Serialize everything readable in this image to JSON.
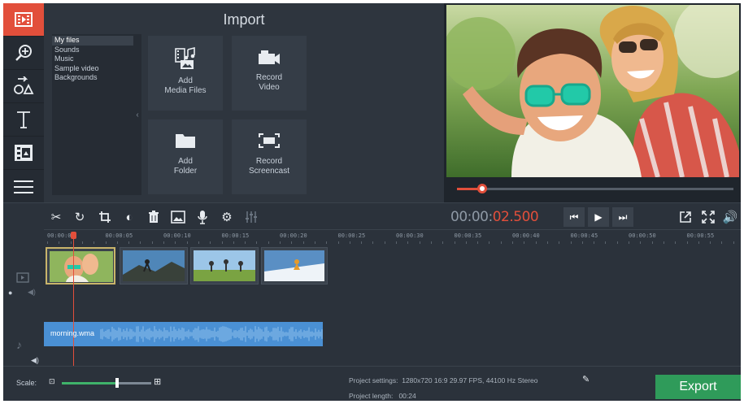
{
  "sidebar": {
    "items": [
      {
        "icon": "import-film-icon",
        "active": true
      },
      {
        "icon": "magic-wand-search-icon",
        "active": false
      },
      {
        "icon": "transitions-shapes-icon",
        "active": false
      },
      {
        "icon": "text-t-icon",
        "active": false
      },
      {
        "icon": "stickers-icon",
        "active": false
      },
      {
        "icon": "menu-list-icon",
        "active": false
      }
    ]
  },
  "import": {
    "title": "Import",
    "categories": [
      "My files",
      "Sounds",
      "Music",
      "Sample video",
      "Backgrounds"
    ],
    "selected_category": "My files",
    "tiles": {
      "add_media": "Add\nMedia Files",
      "record_video": "Record\nVideo",
      "add_folder": "Add\nFolder",
      "record_screencast": "Record\nScreencast"
    }
  },
  "player": {
    "progress": 0.09,
    "timecode_gray": "00:00:",
    "timecode_red": "02.500"
  },
  "ruler": {
    "ticks": [
      "00:00:00",
      "00:00:05",
      "00:00:10",
      "00:00:15",
      "00:00:20",
      "00:00:25",
      "00:00:30",
      "00:00:35",
      "00:00:40",
      "00:00:45",
      "00:00:50",
      "00:00:55"
    ]
  },
  "timeline": {
    "audio_clip": "morning.wma"
  },
  "bottom": {
    "scale_label": "Scale:",
    "scale_value": 0.62,
    "settings_label": "Project settings:",
    "settings_value": "1280x720 16:9 29.97 FPS, 44100 Hz Stereo",
    "length_label": "Project length:",
    "length_value": "00:24",
    "export_label": "Export"
  },
  "colors": {
    "accent_red": "#e24f3b",
    "export_green": "#2f9b5a",
    "audio_blue": "#4a90d4",
    "scale_green": "#3fb36a"
  }
}
